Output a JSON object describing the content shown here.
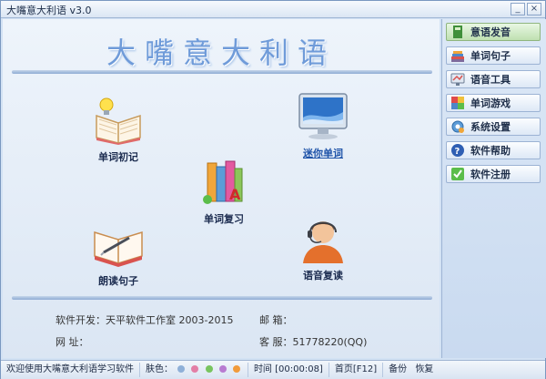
{
  "window": {
    "title": "大嘴意大利语 v3.0"
  },
  "app_title": "大嘴意大利语",
  "features": [
    {
      "label": "单词初记"
    },
    {
      "label": "迷你单词"
    },
    {
      "label": "单词复习"
    },
    {
      "label": "朗读句子"
    },
    {
      "label": "语音复读"
    }
  ],
  "info": {
    "developer": "软件开发：天平软件工作室 2003-2015",
    "email_label": "邮      箱：",
    "website_label": "网      址：",
    "service_label": "客      服：51778220(QQ)"
  },
  "sidebar": {
    "items": [
      {
        "label": "意语发音"
      },
      {
        "label": "单词句子"
      },
      {
        "label": "语音工具"
      },
      {
        "label": "单词游戏"
      },
      {
        "label": "系统设置"
      },
      {
        "label": "软件帮助"
      },
      {
        "label": "软件注册"
      }
    ]
  },
  "statusbar": {
    "welcome": "欢迎使用大嘴意大利语学习软件",
    "skin_label": "肤色：",
    "skin_colors": [
      "#8fb0d8",
      "#e37fa6",
      "#78c45f",
      "#b87bd1",
      "#f19b3b"
    ],
    "time": "时间 [00:00:08]",
    "home": "首页[F12]",
    "backup": "备份",
    "restore": "恢复"
  }
}
